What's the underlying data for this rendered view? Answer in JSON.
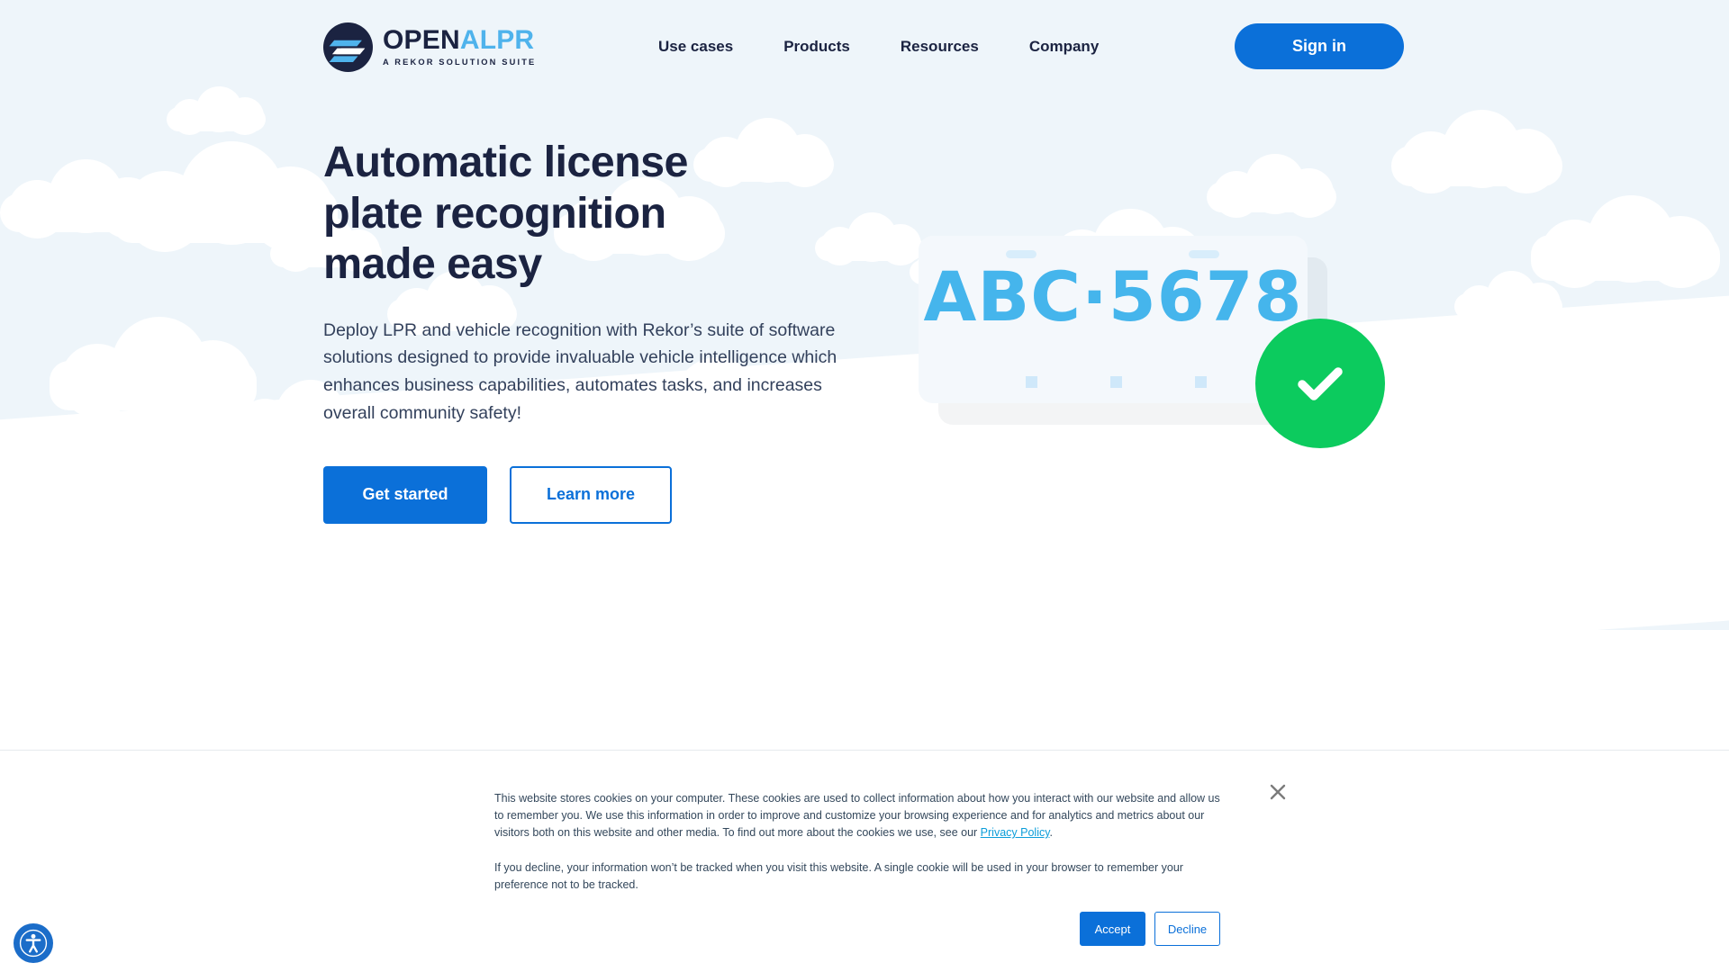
{
  "brand": {
    "logo_name_part1": "OPEN",
    "logo_name_part2": "ALPR",
    "tagline": "A REKOR SOLUTION SUITE",
    "accent_blue": "#0b70d9",
    "logo_light_blue": "#4fb3ec",
    "navy": "#1b2341",
    "success_green": "#0ccb5e"
  },
  "header": {
    "nav_items": [
      {
        "label": "Use cases"
      },
      {
        "label": "Products"
      },
      {
        "label": "Resources"
      },
      {
        "label": "Company"
      }
    ],
    "signin_label": "Sign in"
  },
  "hero": {
    "title_line1": "Automatic license",
    "title_line2": "plate recognition",
    "title_line3": "made easy",
    "paragraph": "Deploy LPR and vehicle recognition with Rekor’s suite of software solutions designed to provide invaluable vehicle intelligence which enhances business capabilities, automates tasks, and increases overall community safety!",
    "primary_cta": "Get started",
    "secondary_cta": "Learn more",
    "plate_number": "ABC·5678",
    "check_icon": "check-icon"
  },
  "cookie_banner": {
    "paragraph1_before_link": "This website stores cookies on your computer. These cookies are used to collect information about how you interact with our website and allow us to remember you. We use this information in order to improve and customize your browsing experience and for analytics and metrics about our visitors both on this website and other media. To find out more about the cookies we use, see our ",
    "privacy_link": "Privacy Policy",
    "paragraph1_after_link": ".",
    "paragraph2": "If you decline, your information won’t be tracked when you visit this website. A single cookie will be used in your browser to remember your preference not to be tracked.",
    "accept_label": "Accept",
    "decline_label": "Decline",
    "close_icon": "close-icon"
  },
  "accessibility_widget": {
    "icon": "accessibility-icon"
  }
}
